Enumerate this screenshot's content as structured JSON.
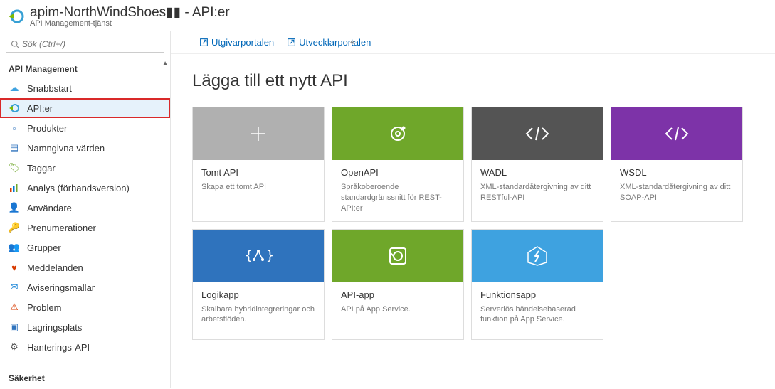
{
  "header": {
    "title": "apim-NorthWindShoes▮▮ - API:er",
    "subtitle": "API Management-tjänst"
  },
  "search": {
    "placeholder": "Sök (Ctrl+/)"
  },
  "sidebar": {
    "section1": "API Management",
    "items": [
      {
        "label": "Snabbstart"
      },
      {
        "label": "API:er"
      },
      {
        "label": "Produkter"
      },
      {
        "label": "Namngivna värden"
      },
      {
        "label": "Taggar"
      },
      {
        "label": "Analys (förhandsversion)"
      },
      {
        "label": "Användare"
      },
      {
        "label": "Prenumerationer"
      },
      {
        "label": "Grupper"
      },
      {
        "label": "Meddelanden"
      },
      {
        "label": "Aviseringsmallar"
      },
      {
        "label": "Problem"
      },
      {
        "label": "Lagringsplats"
      },
      {
        "label": "Hanterings-API"
      }
    ],
    "section2": "Säkerhet"
  },
  "topbar": {
    "link1": "Utgivarportalen",
    "link2": "Utvecklarportalen"
  },
  "page": {
    "title": "Lägga till ett nytt API"
  },
  "tiles": [
    {
      "title": "Tomt API",
      "desc": "Skapa ett tomt API"
    },
    {
      "title": "OpenAPI",
      "desc": "Språkoberoende standardgränssnitt för REST-API:er"
    },
    {
      "title": "WADL",
      "desc": "XML-standardåtergivning av ditt RESTful-API"
    },
    {
      "title": "WSDL",
      "desc": "XML-standardåtergivning av ditt SOAP-API"
    },
    {
      "title": "Logikapp",
      "desc": "Skalbara hybridintegreringar och arbetsflöden."
    },
    {
      "title": "API-app",
      "desc": "API på App Service."
    },
    {
      "title": "Funktionsapp",
      "desc": "Serverlös händelsebaserad funktion på App Service."
    }
  ]
}
